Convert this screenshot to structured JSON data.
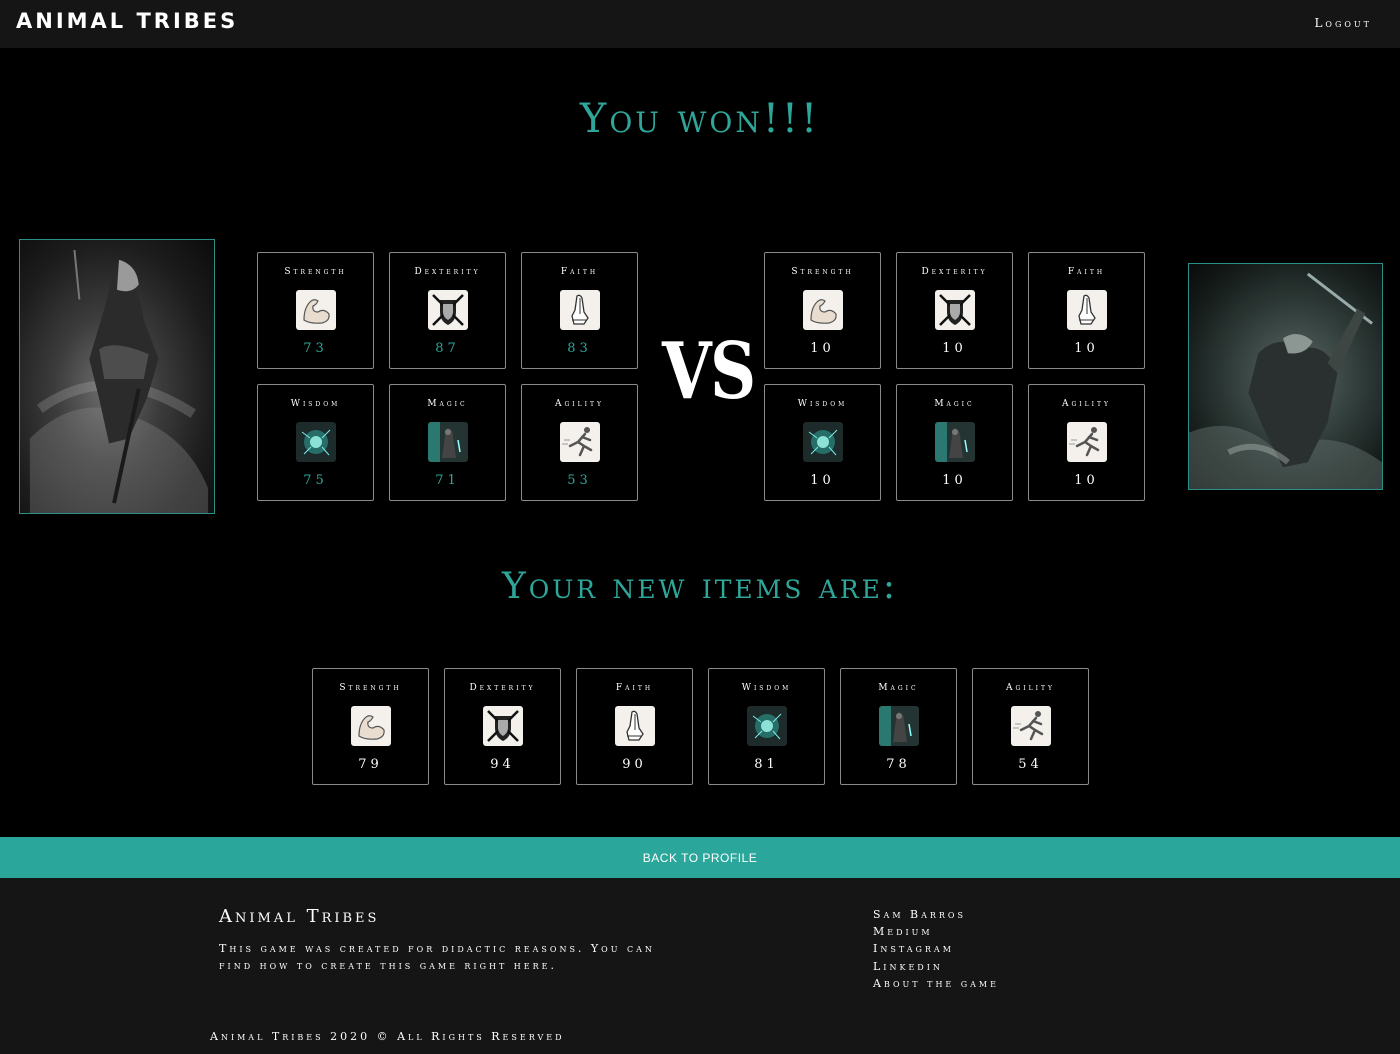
{
  "nav": {
    "brand": "ANIMAL TRIBES",
    "logout": "Logout"
  },
  "result": {
    "title": "You won!!!",
    "vs": "VS"
  },
  "player": {
    "stats": [
      {
        "label": "Strength",
        "value": "73",
        "icon": "flexed-arm-icon"
      },
      {
        "label": "Dexterity",
        "value": "87",
        "icon": "crossed-swords-shield-icon"
      },
      {
        "label": "Faith",
        "value": "83",
        "icon": "praying-hands-icon"
      },
      {
        "label": "Wisdom",
        "value": "75",
        "icon": "glowing-orb-icon"
      },
      {
        "label": "Magic",
        "value": "71",
        "icon": "mage-figure-icon"
      },
      {
        "label": "Agility",
        "value": "53",
        "icon": "runner-icon"
      }
    ]
  },
  "opponent": {
    "stats": [
      {
        "label": "Strength",
        "value": "10",
        "icon": "flexed-arm-icon"
      },
      {
        "label": "Dexterity",
        "value": "10",
        "icon": "crossed-swords-shield-icon"
      },
      {
        "label": "Faith",
        "value": "10",
        "icon": "praying-hands-icon"
      },
      {
        "label": "Wisdom",
        "value": "10",
        "icon": "glowing-orb-icon"
      },
      {
        "label": "Magic",
        "value": "10",
        "icon": "mage-figure-icon"
      },
      {
        "label": "Agility",
        "value": "10",
        "icon": "runner-icon"
      }
    ]
  },
  "new_items": {
    "title": "Your new items are:",
    "items": [
      {
        "label": "Strength",
        "value": "79",
        "icon": "flexed-arm-icon"
      },
      {
        "label": "Dexterity",
        "value": "94",
        "icon": "crossed-swords-shield-icon"
      },
      {
        "label": "Faith",
        "value": "90",
        "icon": "praying-hands-icon"
      },
      {
        "label": "Wisdom",
        "value": "81",
        "icon": "glowing-orb-icon"
      },
      {
        "label": "Magic",
        "value": "78",
        "icon": "mage-figure-icon"
      },
      {
        "label": "Agility",
        "value": "54",
        "icon": "runner-icon"
      }
    ]
  },
  "back_button": "BACK TO PROFILE",
  "footer": {
    "title": "Animal Tribes",
    "description": "This game was created for didactic reasons. You can find how to create this game right here.",
    "links": [
      "Sam Barros",
      "Medium",
      "Instagram",
      "Linkedin",
      "About the game"
    ],
    "copyright": "Animal Tribes 2020 © All Rights Reserved"
  },
  "colors": {
    "accent": "#2fa69a",
    "button": "#2aa69a",
    "navbar": "#151515",
    "background": "#000000"
  }
}
